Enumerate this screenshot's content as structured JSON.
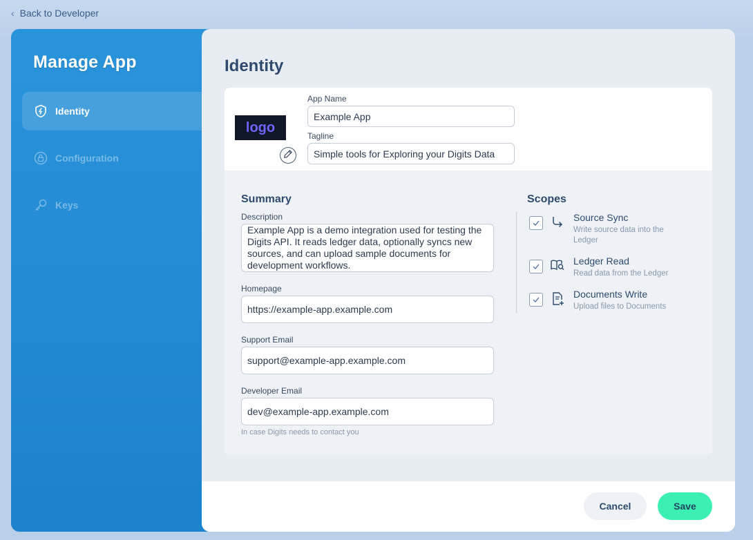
{
  "nav": {
    "back_label": "Back to Developer"
  },
  "sidebar": {
    "title": "Manage App",
    "items": [
      {
        "label": "Identity",
        "icon": "shield-icon",
        "active": true
      },
      {
        "label": "Configuration",
        "icon": "lock-icon",
        "active": false
      },
      {
        "label": "Keys",
        "icon": "key-icon",
        "active": false
      }
    ]
  },
  "page": {
    "title": "Identity"
  },
  "identity": {
    "logo_text": "logo",
    "app_name_label": "App Name",
    "app_name_value": "Example App",
    "tagline_label": "Tagline",
    "tagline_value": "Simple tools for Exploring your Digits Data"
  },
  "summary": {
    "title": "Summary",
    "description_label": "Description",
    "description_value": "Example App is a demo integration used for testing the Digits API. It reads ledger data, optionally syncs new sources, and can upload sample documents for development workflows.",
    "homepage_label": "Homepage",
    "homepage_value": "https://example-app.example.com",
    "support_email_label": "Support Email",
    "support_email_value": "support@example-app.example.com",
    "developer_email_label": "Developer Email",
    "developer_email_value": "dev@example-app.example.com",
    "developer_email_helper": "In case Digits needs to contact you"
  },
  "scopes": {
    "title": "Scopes",
    "items": [
      {
        "title": "Source Sync",
        "description": "Write source data into the Ledger",
        "checked": true,
        "icon": "arrow-turn-icon"
      },
      {
        "title": "Ledger Read",
        "description": "Read data from the Ledger",
        "checked": true,
        "icon": "book-search-icon"
      },
      {
        "title": "Documents Write",
        "description": "Upload files to Documents",
        "checked": true,
        "icon": "document-add-icon"
      }
    ]
  },
  "footer": {
    "cancel_label": "Cancel",
    "save_label": "Save"
  },
  "colors": {
    "sidebar": "#2189d2",
    "save_button": "#3cf0b4",
    "title_text": "#2f4a6e"
  }
}
